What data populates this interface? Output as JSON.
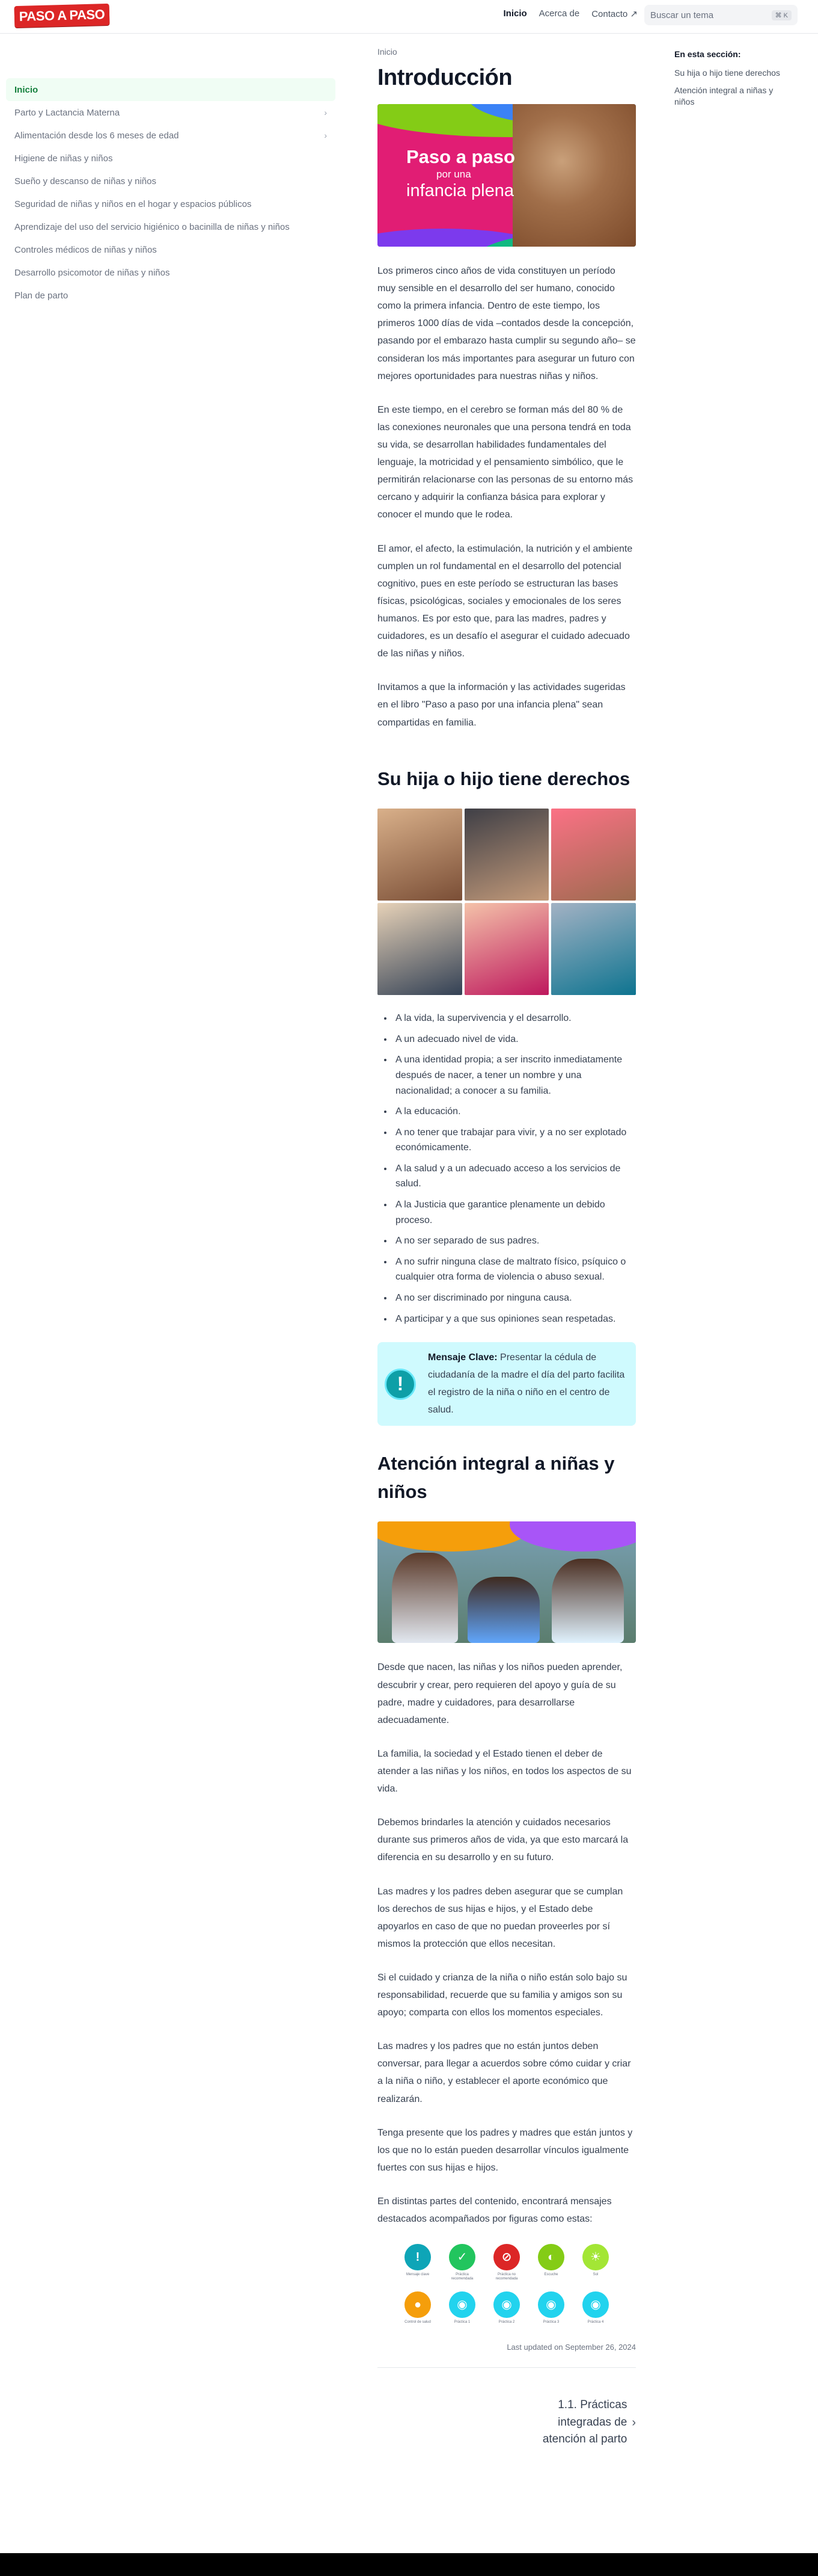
{
  "header": {
    "logo_text": "PASO A PASO",
    "nav": [
      {
        "label": "Inicio",
        "active": true
      },
      {
        "label": "Acerca de",
        "active": false
      },
      {
        "label": "Contacto ↗",
        "active": false
      }
    ],
    "search_placeholder": "Buscar un tema",
    "search_shortcut": "⌘ K"
  },
  "sidebar": {
    "items": [
      {
        "label": "Inicio",
        "active": true,
        "expandable": false
      },
      {
        "label": "Parto y Lactancia Materna",
        "active": false,
        "expandable": true
      },
      {
        "label": "Alimentación desde los 6 meses de edad",
        "active": false,
        "expandable": true
      },
      {
        "label": "Higiene de niñas y niños",
        "active": false,
        "expandable": false
      },
      {
        "label": "Sueño y descanso de niñas y niños",
        "active": false,
        "expandable": false
      },
      {
        "label": "Seguridad de niñas y niños en el hogar y espacios públicos",
        "active": false,
        "expandable": false
      },
      {
        "label": "Aprendizaje del uso del servicio higiénico o bacinilla de niñas y niños",
        "active": false,
        "expandable": false
      },
      {
        "label": "Controles médicos de niñas y niños",
        "active": false,
        "expandable": false
      },
      {
        "label": "Desarrollo psicomotor de niñas y niños",
        "active": false,
        "expandable": false
      },
      {
        "label": "Plan de parto",
        "active": false,
        "expandable": false
      }
    ]
  },
  "toc": {
    "title": "En esta sección:",
    "links": [
      "Su hija o hijo tiene derechos",
      "Atención integral a niñas y niños"
    ]
  },
  "main": {
    "breadcrumb": "Inicio",
    "title": "Introducción",
    "hero": {
      "line1": "Paso a paso",
      "line2": "por una",
      "line3": "infancia plena"
    },
    "intro_paragraphs": [
      "Los primeros cinco años de vida constituyen un período muy sensible en el desarrollo del ser humano, conocido como la primera infancia. Dentro de este tiempo, los primeros 1000 días de vida –contados desde la concepción, pasando por el embarazo hasta cumplir su segundo año– se consideran los más importantes para asegurar un futuro con mejores oportunidades para nuestras niñas y niños.",
      "En este tiempo, en el cerebro se forman más del 80 % de las conexiones neuronales que una persona tendrá en toda su vida, se desarrollan habilidades fundamentales del lenguaje, la motricidad y el pensamiento simbólico, que le permitirán relacionarse con las personas de su entorno más cercano y adquirir la confianza básica para explorar y conocer el mundo que le rodea.",
      "El amor, el afecto, la estimulación, la nutrición y el ambiente cumplen un rol fundamental en el desarrollo del potencial cognitivo, pues en este período se estructuran las bases físicas, psicológicas, sociales y emocionales de los seres humanos. Es por esto que, para las madres, padres y cuidadores, es un desafío el asegurar el cuidado adecuado de las niñas y niños.",
      "Invitamos a que la información y las actividades sugeridas en el libro \"Paso a paso por una infancia plena\" sean compartidas en familia."
    ],
    "rights_heading": "Su hija o hijo tiene derechos",
    "rights": [
      "A la vida, la supervivencia y el desarrollo.",
      "A un adecuado nivel de vida.",
      "A una identidad propia; a ser inscrito inmediatamente después de nacer, a tener un nombre y una nacionalidad; a conocer a su familia.",
      "A la educación.",
      "A no tener que trabajar para vivir, y a no ser explotado económicamente.",
      "A la salud y a un adecuado acceso a los servicios de salud.",
      "A la Justicia que garantice plenamente un debido proceso.",
      "A no ser separado de sus padres.",
      "A no sufrir ninguna clase de maltrato físico, psíquico o cualquier otra forma de violencia o abuso sexual.",
      "A no ser discriminado por ninguna causa.",
      "A participar y a que sus opiniones sean respetadas."
    ],
    "callout": {
      "icon": "!",
      "label": "Mensaje Clave:",
      "text": " Presentar la cédula de ciudadanía de la madre el día del parto facilita el registro de la niña o niño en el centro de salud."
    },
    "care_heading": "Atención integral a niñas y niños",
    "care_paragraphs": [
      "Desde que nacen, las niñas y los niños pueden aprender, descubrir y crear, pero requieren del apoyo y guía de su padre, madre y cuidadores, para desarrollarse adecuadamente.",
      "La familia, la sociedad y el Estado tienen el deber de atender a las niñas y los niños, en todos los aspectos de su vida.",
      "Debemos brindarles la atención y cuidados necesarios durante sus primeros años de vida, ya que esto marcará la diferencia en su desarrollo y en su futuro.",
      "Las madres y los padres deben asegurar que se cumplan los derechos de sus hijas e hijos, y el Estado debe apoyarlos en caso de que no puedan proveerles por sí mismos la protección que ellos necesitan.",
      "Si el cuidado y crianza de la niña o niño están solo bajo su responsabilidad, recuerde que su familia y amigos son su apoyo; comparta con ellos los momentos especiales.",
      "Las madres y los padres que no están juntos deben conversar, para llegar a acuerdos sobre cómo cuidar y criar a la niña o niño, y establecer el aporte económico que realizarán.",
      "Tenga presente que los padres y madres que están juntos y los que no lo están pueden desarrollar vínculos igualmente fuertes con sus hijas e hijos.",
      "En distintas partes del contenido, encontrará mensajes destacados acompañados por figuras como estas:"
    ],
    "legend_icons": [
      {
        "name": "Mensaje clave",
        "glyph": "!",
        "color": "#0ea5b7"
      },
      {
        "name": "Práctica recomendada",
        "glyph": "✓",
        "color": "#22c55e"
      },
      {
        "name": "Práctica no recomendada",
        "glyph": "⊘",
        "color": "#dc2626"
      },
      {
        "name": "Escuche",
        "glyph": "◐",
        "color": "#84cc16"
      },
      {
        "name": "Sol",
        "glyph": "☀",
        "color": "#a3e635"
      },
      {
        "name": "Control de salud",
        "glyph": "●",
        "color": "#f59e0b"
      },
      {
        "name": "Práctica 1",
        "glyph": "◉",
        "color": "#22d3ee"
      },
      {
        "name": "Práctica 2",
        "glyph": "◉",
        "color": "#22d3ee"
      },
      {
        "name": "Práctica 3",
        "glyph": "◉",
        "color": "#22d3ee"
      },
      {
        "name": "Práctica 4",
        "glyph": "◉",
        "color": "#22d3ee"
      }
    ],
    "last_updated": "Last updated on September 26, 2024",
    "next_link": {
      "label_line1": "1.1. Prácticas",
      "label_line2": "integradas de",
      "label_line3": "atención al parto",
      "arrow": "›"
    }
  }
}
